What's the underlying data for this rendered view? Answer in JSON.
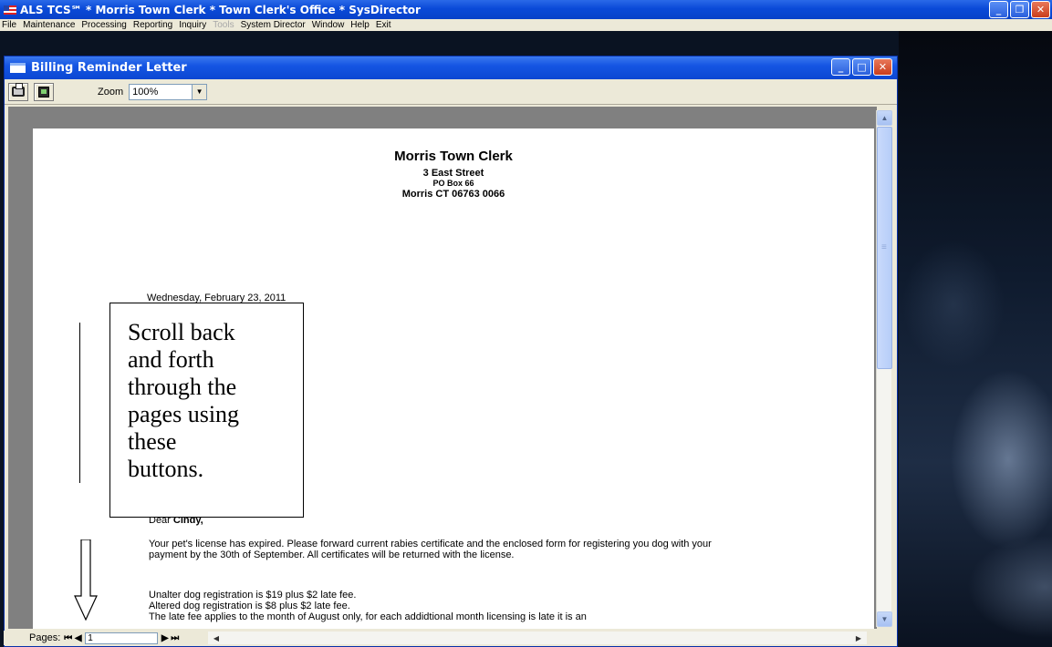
{
  "app": {
    "title": "ALS TCS℠ * Morris Town Clerk * Town Clerk's Office * SysDirector"
  },
  "menu": {
    "items": [
      "File",
      "Maintenance",
      "Processing",
      "Reporting",
      "Inquiry",
      "Tools",
      "System Director",
      "Window",
      "Help",
      "Exit"
    ],
    "disabled": [
      "Tools"
    ]
  },
  "window": {
    "title": "Billing Reminder Letter"
  },
  "toolbar": {
    "zoom_label": "Zoom",
    "zoom_value": "100%"
  },
  "letter": {
    "org_name": "Morris Town Clerk",
    "address1": "3 East Street",
    "address2": "PO Box 66",
    "address3": "Morris CT 06763 0066",
    "date": "Wednesday, February 23, 2011",
    "salutation_prefix": "Dear",
    "salutation_name": "Cindy,",
    "paragraph1": "Your pet's license has expired.  Please forward current rabies certificate and the enclosed form for registering you dog with your payment by the 30th of September.  All certificates will be returned with the license.",
    "line_unaltered": "Unalter dog registration is $19 plus $2 late fee.",
    "line_altered": "Altered dog registration is $8 plus $2 late fee.",
    "line_late": "The late fee applies to the month of August  only, for each addidtional month licensing is late it is an"
  },
  "annotation": {
    "line1": "Scroll back",
    "line2": "and forth",
    "line3": "through the",
    "line4": "pages using",
    "line5": "these",
    "line6": "buttons."
  },
  "pagebar": {
    "label": "Pages:",
    "current_page": "1"
  },
  "colors": {
    "titlebar_blue": "#0a4ad8",
    "chrome_beige": "#ece9d8",
    "viewport_gray": "#808080",
    "close_red": "#c93d1c"
  },
  "icons": {
    "print": "printer-icon",
    "export": "export-icon",
    "first": "first-page-icon",
    "prev": "prev-page-icon",
    "next": "next-page-icon",
    "last": "last-page-icon"
  }
}
